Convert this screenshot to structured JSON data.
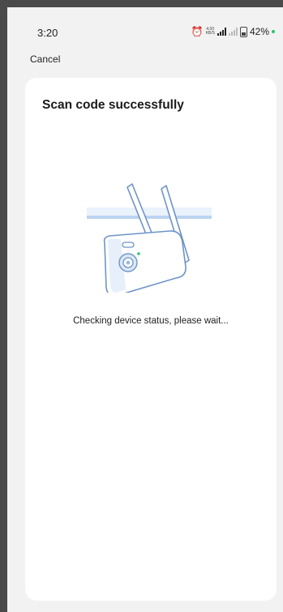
{
  "status_bar": {
    "time": "3:20",
    "network_speed_value": "4.00",
    "network_speed_unit": "KB/S",
    "battery_percent": "42%"
  },
  "nav": {
    "cancel_label": "Cancel"
  },
  "card": {
    "title": "Scan code successfully",
    "status_message": "Checking device status, please wait..."
  },
  "icons": [
    "alarm-clock-icon",
    "signal-icon",
    "battery-icon",
    "camera-illustration"
  ],
  "colors": {
    "accent_blue": "#bcd4f0",
    "card_bg": "#ffffff",
    "page_bg": "#f2f2f2",
    "status_dot": "#2cc36b"
  }
}
